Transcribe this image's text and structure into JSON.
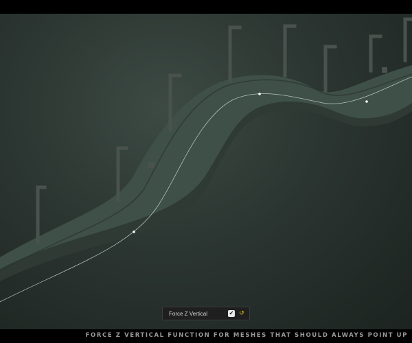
{
  "viewport": {
    "background": "#2b3531",
    "road_color": "#3f5048",
    "road_side_color": "#2f3a35",
    "spline_color": "#cfe3d6",
    "lamp_color": "#4a524e"
  },
  "property": {
    "label": "Force Z Vertical",
    "checked": true,
    "checkmark_glyph": "✔",
    "reset_glyph": "↺",
    "checkbox_icon": "checkbox-checked-icon",
    "reset_icon": "reset-arrow-icon",
    "reset_color": "#e0c21a"
  },
  "caption": "FORCE Z VERTICAL FUNCTION FOR MESHES THAT SHOULD ALWAYS POINT UP"
}
